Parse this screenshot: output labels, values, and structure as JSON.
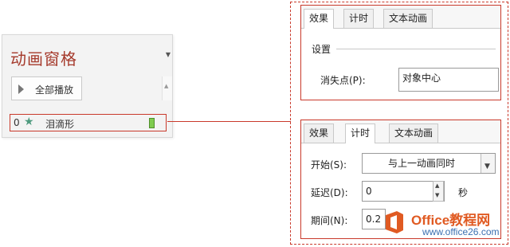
{
  "animation_pane": {
    "title": "动画窗格",
    "play_all_label": "全部播放",
    "item": {
      "number": "0",
      "name": "泪滴形"
    }
  },
  "effect_panel": {
    "tabs": [
      "效果",
      "计时",
      "文本动画"
    ],
    "active_tab": "效果",
    "section_label": "设置",
    "vanish_point_label": "消失点(P):",
    "vanish_point_value": "对象中心"
  },
  "timing_panel": {
    "tabs": [
      "效果",
      "计时",
      "文本动画"
    ],
    "active_tab": "计时",
    "start_label": "开始(S):",
    "start_value": "与上一动画同时",
    "delay_label": "延迟(D):",
    "delay_value": "0",
    "delay_unit": "秒",
    "duration_label": "期间(N):",
    "duration_value": "0.2"
  },
  "watermark": {
    "brand": "Office教程网",
    "url": "www.office26.com"
  },
  "colors": {
    "accent_red": "#c9392b",
    "title_red": "#a5392b",
    "star_green": "#4e9a7e",
    "bar_green": "#7fcb4f",
    "wm_orange": "#e05a22",
    "wm_blue": "#3a6fb0"
  }
}
